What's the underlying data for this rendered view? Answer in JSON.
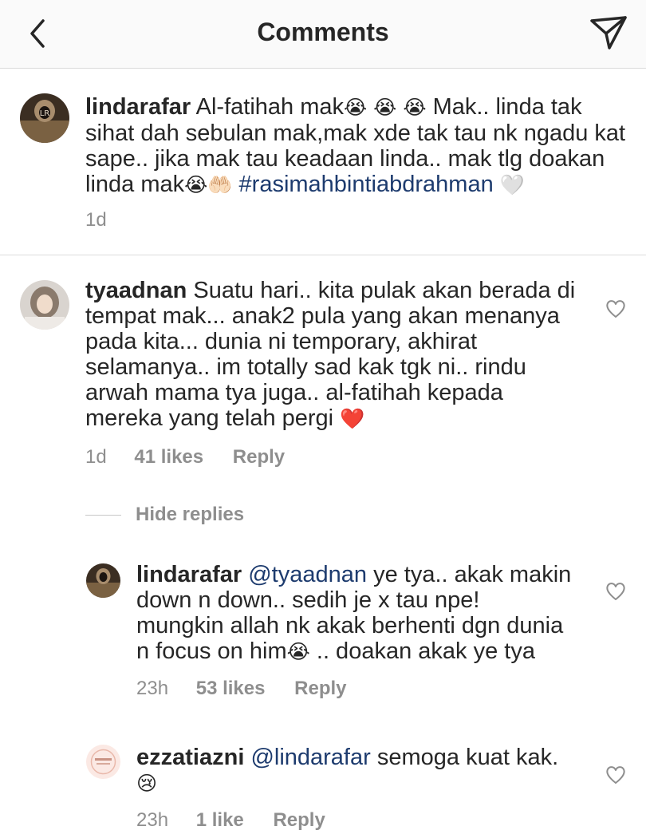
{
  "header": {
    "title": "Comments"
  },
  "caption": {
    "username": "lindarafar",
    "text_a": "Al-fatihah mak",
    "emoji_a": "😭 😭 😭",
    "text_b": "Mak.. linda tak",
    "line2": "sihat dah sebulan mak,mak xde tak tau nk ngadu kat",
    "line3": "sape.. jika mak tau keadaan linda.. mak tlg doakan",
    "line4_a": "linda mak",
    "emoji_b": "😭🤲🏻",
    "hashtag": "#rasimahbintiabdrahman",
    "emoji_c": "🤍",
    "time": "1d"
  },
  "comments": [
    {
      "username": "tyaadnan",
      "line1": "Suatu hari.. kita pulak akan berada di",
      "line2": "tempat mak... anak2 pula yang akan menanya",
      "line3": "pada kita... dunia ni temporary, akhirat",
      "line4": "selamanya.. im totally sad kak tgk ni.. rindu",
      "line5": "arwah mama tya juga.. al-fatihah kepada",
      "line6": "mereka yang telah pergi",
      "emoji": "❤️",
      "time": "1d",
      "likes": "41 likes",
      "reply": "Reply"
    }
  ],
  "hide_replies": "Hide replies",
  "replies": [
    {
      "username": "lindarafar",
      "mention": "@tyaadnan",
      "line1": "ye tya.. akak makin",
      "line2": "down n down.. sedih je x tau npe!",
      "line3": "mungkin allah nk akak berhenti dgn dunia",
      "line4_a": "n focus on him",
      "emoji": "😭",
      "line4_b": ".. doakan akak ye tya",
      "time": "23h",
      "likes": "53 likes",
      "reply": "Reply"
    },
    {
      "username": "ezzatiazni",
      "mention": "@lindarafar",
      "line1": "semoga kuat kak.",
      "emoji": "😢",
      "time": "23h",
      "likes": "1 like",
      "reply": "Reply"
    }
  ]
}
